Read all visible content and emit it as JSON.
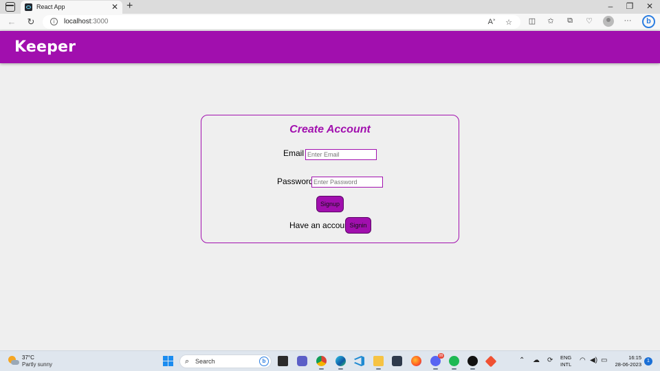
{
  "browser": {
    "tab_title": "React App",
    "url_host": "localhost",
    "url_port": ":3000"
  },
  "app": {
    "title": "Keeper"
  },
  "signup": {
    "heading": "Create Account",
    "email_label": "Email",
    "email_placeholder": "Enter Email",
    "password_label": "Password",
    "password_placeholder": "Enter Password",
    "signup_button": "Signup",
    "have_account_text": "Have an account?",
    "signin_button": "Signin"
  },
  "taskbar": {
    "weather_temp": "37°C",
    "weather_condition": "Partly sunny",
    "search_label": "Search",
    "lang_line1": "ENG",
    "lang_line2": "INTL",
    "time": "16:15",
    "date": "28-06-2023",
    "notification_count": "1",
    "discord_badge": "99"
  },
  "colors": {
    "accent": "#a10fae",
    "page_background": "#efefef"
  },
  "icons": [
    "tab-actions-icon",
    "react-favicon-icon",
    "close-icon",
    "plus-icon",
    "minimize-icon",
    "restore-icon",
    "back-arrow-icon",
    "refresh-icon",
    "info-icon",
    "read-aloud-icon",
    "star-icon",
    "split-screen-icon",
    "favorites-icon",
    "collections-icon",
    "browser-essentials-icon",
    "profile-icon",
    "more-icon",
    "bing-icon",
    "weather-icon",
    "windows-start-icon",
    "search-icon",
    "file-explorer-icon",
    "teams-icon",
    "chrome-icon",
    "edge-icon",
    "vscode-icon",
    "folder-icon",
    "store-icon",
    "firefox-icon",
    "discord-icon",
    "spotify-icon",
    "media-player-icon",
    "git-icon",
    "chevron-up-icon",
    "onedrive-icon",
    "sync-icon",
    "wifi-icon",
    "volume-icon",
    "battery-icon"
  ]
}
